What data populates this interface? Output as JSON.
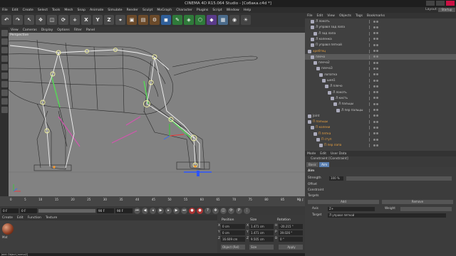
{
  "window": {
    "title": "CINEMA 4D R15.064 Studio - [Собака.c4d *]"
  },
  "menubar": {
    "items": [
      "File",
      "Edit",
      "Create",
      "Select",
      "Tools",
      "Mesh",
      "Snap",
      "Animate",
      "Simulate",
      "Render",
      "Sculpt",
      "MoGraph",
      "Character",
      "Plugins",
      "Script",
      "Window",
      "Help"
    ],
    "layout_label": "Layout:",
    "layout_value": "Startup"
  },
  "toolbar": {
    "axis_labels": [
      "X",
      "Y",
      "Z"
    ]
  },
  "viewport": {
    "menu": [
      "View",
      "Cameras",
      "Display",
      "Options",
      "Filter",
      "Panel"
    ],
    "label": "Perspective"
  },
  "timeline": {
    "ticks": [
      "0",
      "5",
      "10",
      "15",
      "20",
      "25",
      "30",
      "35",
      "40",
      "45",
      "50",
      "55",
      "60",
      "65",
      "70",
      "75",
      "80",
      "85",
      "90"
    ],
    "end_frame": "0 F"
  },
  "transport": {
    "current_frame": "0 F",
    "start_frame": "0 F",
    "end_frame_field": "90 F",
    "max_frame": "90 F"
  },
  "materials": {
    "menu": [
      "Create",
      "Edit",
      "Function",
      "Texture"
    ],
    "material_name": "Mat"
  },
  "coordinates": {
    "headers": [
      "Position",
      "Size",
      "Rotation"
    ],
    "rows": [
      {
        "axis": "X",
        "pos": "0 cm",
        "size_axis": "X",
        "size": "1.471 cm",
        "rot_axis": "H",
        "rot": "-20.215 °"
      },
      {
        "axis": "Y",
        "pos": "0 cm",
        "size_axis": "Y",
        "size": "1.471 cm",
        "rot_axis": "P",
        "rot": "39.026 °"
      },
      {
        "axis": "Z",
        "pos": "16.609 cm",
        "size_axis": "Z",
        "size": "9.505 cm",
        "rot_axis": "B",
        "rot": "0 °"
      }
    ],
    "mode_button": "Object (Rel)",
    "size_button": "Size",
    "apply_button": "Apply"
  },
  "status": {
    "text": "Joint Object [плечо2]"
  },
  "object_manager": {
    "menu": [
      "File",
      "Edit",
      "View",
      "Objects",
      "Tags",
      "Bookmarks"
    ],
    "rows": [
      {
        "name": "Л локоть",
        "indent": 1,
        "style": "normal"
      },
      {
        "name": "Л управл зад лапа",
        "indent": 1,
        "style": "normal"
      },
      {
        "name": "Л зад лапа",
        "indent": 2,
        "style": "normal"
      },
      {
        "name": "Л коленка",
        "indent": 1,
        "style": "normal"
      },
      {
        "name": "П управл пяткой",
        "indent": 1,
        "style": "normal"
      },
      {
        "name": "хребтец",
        "indent": 0,
        "style": "orange"
      },
      {
        "name": "плечо",
        "indent": 1,
        "style": "sel"
      },
      {
        "name": "плечо2",
        "indent": 2,
        "style": "normal"
      },
      {
        "name": "плечо3",
        "indent": 3,
        "style": "normal"
      },
      {
        "name": "лопатка",
        "indent": 4,
        "style": "normal"
      },
      {
        "name": "шея1",
        "indent": 5,
        "style": "normal"
      },
      {
        "name": "Л плечо",
        "indent": 6,
        "style": "normal"
      },
      {
        "name": "Л локоть",
        "indent": 7,
        "style": "normal"
      },
      {
        "name": "Л кисть",
        "indent": 8,
        "style": "normal"
      },
      {
        "name": "Л пальцы",
        "indent": 9,
        "style": "normal"
      },
      {
        "name": "Л пер пальцы",
        "indent": 10,
        "style": "normal"
      },
      {
        "name": "Joint",
        "indent": 0,
        "style": "normal"
      },
      {
        "name": "П пальцы",
        "indent": 0,
        "style": "orange"
      },
      {
        "name": "П колени",
        "indent": 1,
        "style": "orange"
      },
      {
        "name": "П пятка",
        "indent": 2,
        "style": "orange"
      },
      {
        "name": "П ступ",
        "indent": 3,
        "style": "orange"
      },
      {
        "name": "П пер лапа",
        "indent": 4,
        "style": "orange"
      }
    ]
  },
  "attribute_manager": {
    "menu": [
      "Mode",
      "Edit",
      "User Data"
    ],
    "title": "Constraint [Constraint]",
    "tabs": [
      "Basic",
      "Aim"
    ],
    "active_tab": "Aim",
    "section": "Aim",
    "strength_label": "Strength",
    "strength_value": "100 %",
    "offset_label": "Offset",
    "constraint_label": "Constraint",
    "targets_label": "Targets",
    "add_button": "Add",
    "remove_button": "Remove",
    "axis_label": "Axis",
    "axis_value": "Z+",
    "up_weight_label": "Weight",
    "target_label": "Target",
    "target_value": "Л управл пяткой"
  }
}
